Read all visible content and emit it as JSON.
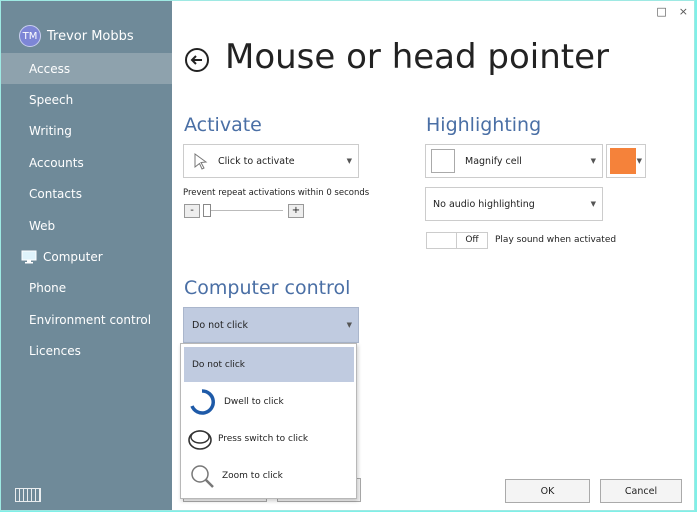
{
  "window_controls": {
    "maximize": "□",
    "close": "×"
  },
  "user": {
    "initials": "TM",
    "name": "Trevor Mobbs"
  },
  "sidebar": {
    "items": [
      {
        "label": "Access",
        "active": true
      },
      {
        "label": "Speech"
      },
      {
        "label": "Writing"
      },
      {
        "label": "Accounts"
      },
      {
        "label": "Contacts"
      },
      {
        "label": "Web"
      },
      {
        "label": "Computer",
        "icon": "monitor-icon"
      },
      {
        "label": "Phone"
      },
      {
        "label": "Environment control"
      },
      {
        "label": "Licences"
      }
    ]
  },
  "page": {
    "title": "Mouse or head pointer"
  },
  "activate": {
    "title": "Activate",
    "mode": "Click to activate",
    "prevent_repeat": "Prevent repeat activations within 0 seconds",
    "minus": "-",
    "plus": "+"
  },
  "highlighting": {
    "title": "Highlighting",
    "style": "Magnify cell",
    "color": "#f5823a",
    "audio": "No audio highlighting",
    "sound_toggle": "Off",
    "sound_label": "Play sound when activated"
  },
  "computer_control": {
    "title": "Computer control",
    "selected": "Do not click",
    "options": [
      {
        "label": "Do not click",
        "icon": ""
      },
      {
        "label": "Dwell to click",
        "icon": "dwell-icon"
      },
      {
        "label": "Press switch to click",
        "icon": "switch-icon"
      },
      {
        "label": "Zoom to click",
        "icon": "zoom-icon"
      }
    ]
  },
  "footer": {
    "ok": "OK",
    "cancel": "Cancel"
  },
  "colors": {
    "sidebar": "#6f8a99",
    "accent": "#4a6fa5",
    "selection": "#c0cbe0"
  }
}
